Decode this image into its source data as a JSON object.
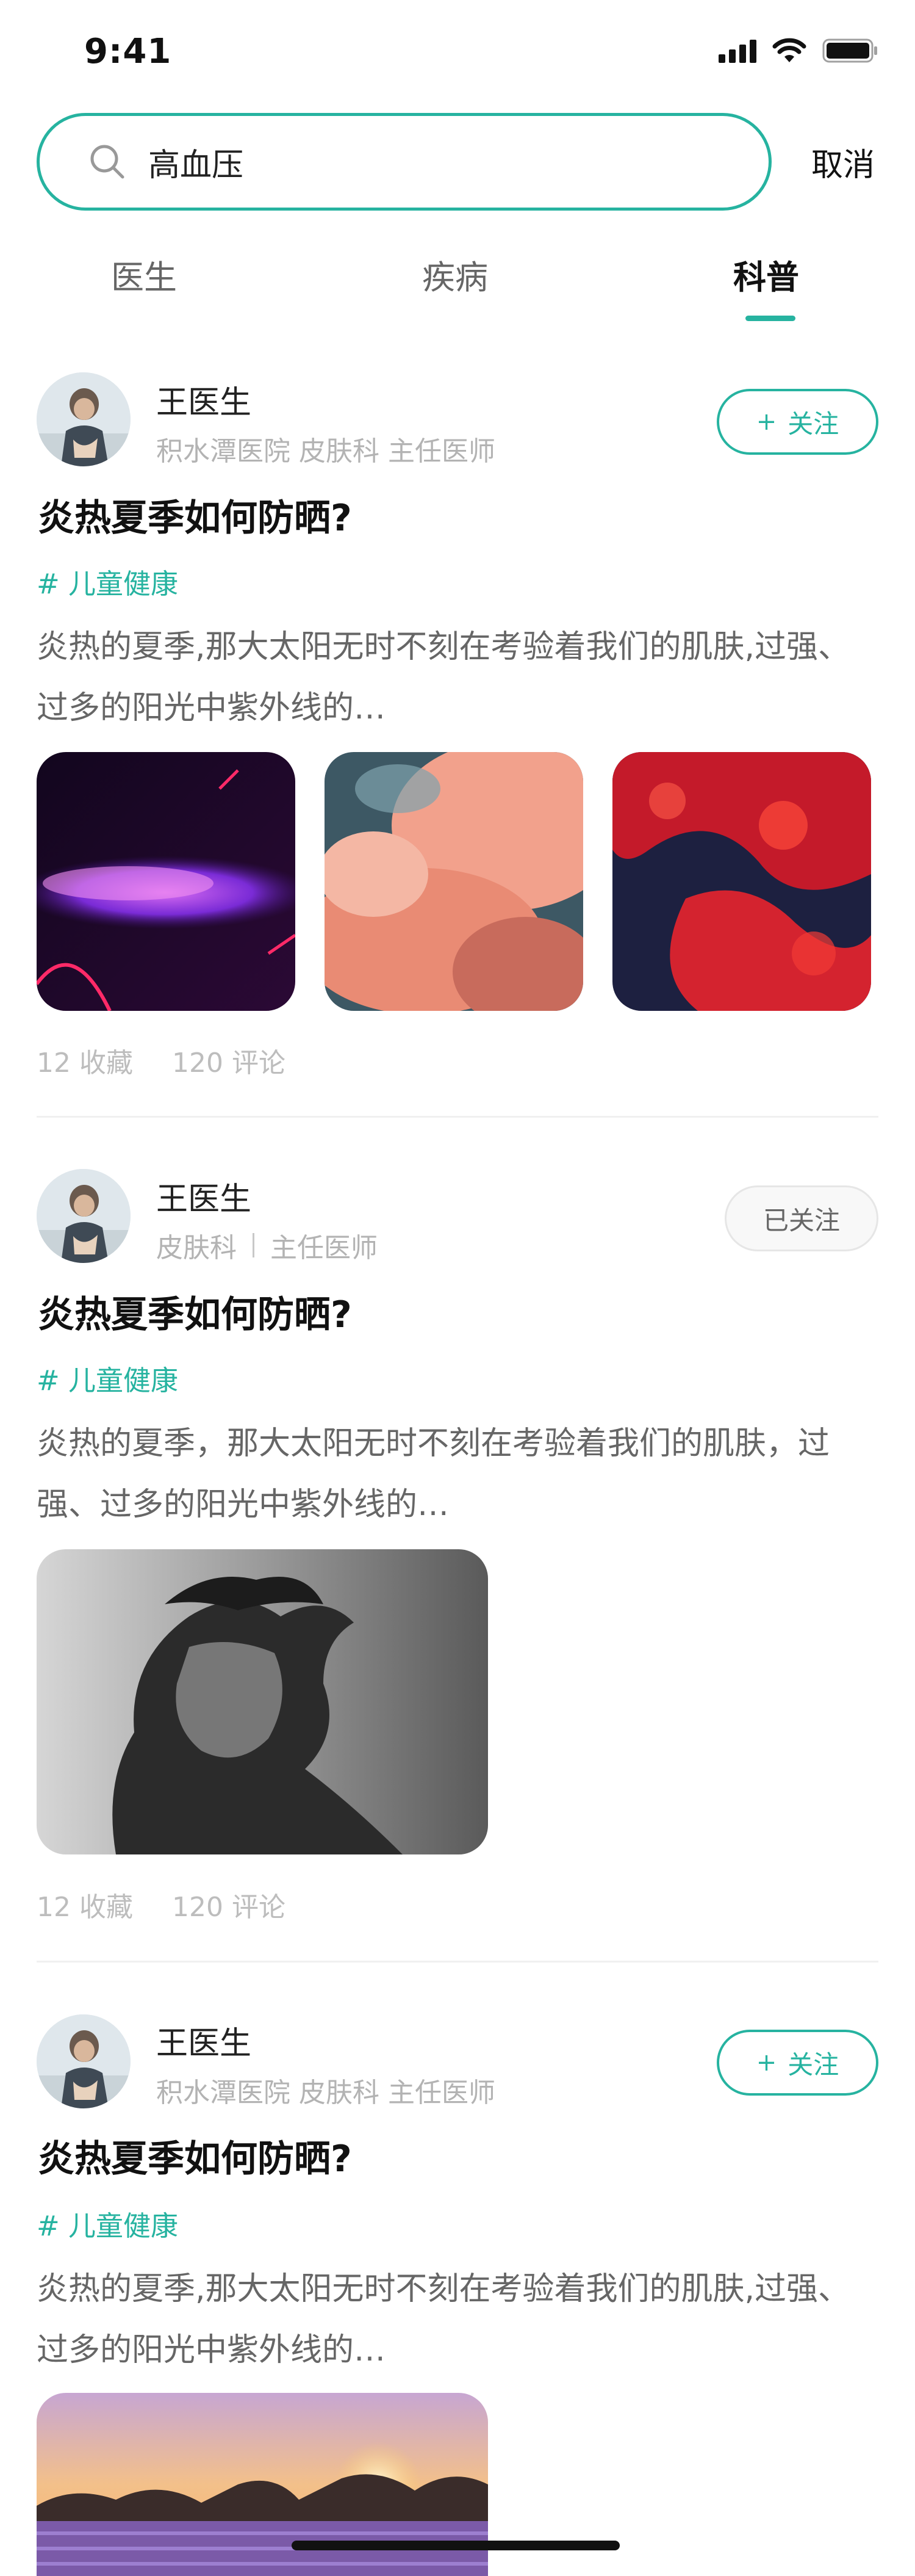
{
  "status_bar": {
    "time": "9:41"
  },
  "search": {
    "query": "高血压",
    "cancel_label": "取消"
  },
  "tabs": [
    {
      "label": "医生",
      "active": false
    },
    {
      "label": "疾病",
      "active": false
    },
    {
      "label": "科普",
      "active": true
    }
  ],
  "posts": [
    {
      "doctor_name": "王医生",
      "doctor_info": "积水潭医院 皮肤科 主任医师",
      "follow_label": "关注",
      "follow_icon": "plus-icon",
      "title": "炎热夏季如何防晒?",
      "tag": "# 儿童健康",
      "excerpt": "炎热的夏季,那大太阳无时不刻在考验着我们的肌肤,过强、过多的阳光中紫外线的…",
      "images": [
        "purple-smoke-image",
        "pink-clouds-image",
        "red-fluid-image"
      ],
      "stats": {
        "favorites": "12 收藏",
        "comments": "120 评论"
      }
    },
    {
      "doctor_name": "王医生",
      "doctor_dept": "皮肤科",
      "doctor_title": "主任医师",
      "follow_label": "已关注",
      "title": "炎热夏季如何防晒?",
      "tag": "# 儿童健康",
      "excerpt": "炎热的夏季，那大太阳无时不刻在考验着我们的肌肤，过强、过多的阳光中紫外线的…",
      "images": [
        "woman-portrait-image"
      ],
      "stats": {
        "favorites": "12 收藏",
        "comments": "120 评论"
      }
    },
    {
      "doctor_name": "王医生",
      "doctor_info": "积水潭医院 皮肤科 主任医师",
      "follow_label": "关注",
      "follow_icon": "plus-icon",
      "title": "炎热夏季如何防晒?",
      "tag": "# 儿童健康",
      "excerpt": "炎热的夏季,那大太阳无时不刻在考验着我们的肌肤,过强、过多的阳光中紫外线的…",
      "images": [
        "lavender-sunset-image"
      ]
    }
  ],
  "colors": {
    "accent": "#26b3a0",
    "muted": "#b3b3b3"
  }
}
